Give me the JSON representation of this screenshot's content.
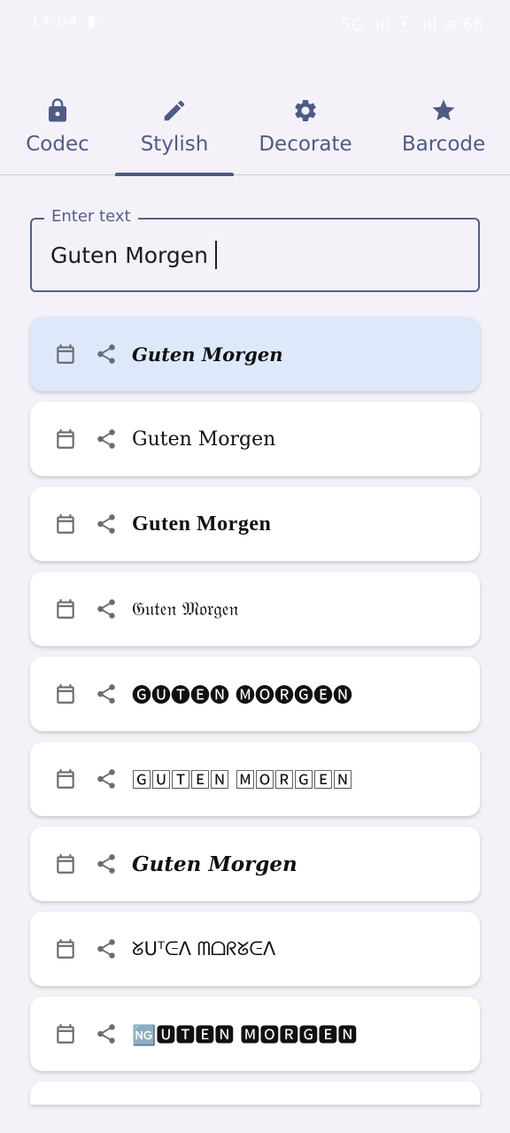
{
  "status_bar": {
    "time": "14:04",
    "left_icons": "▮ · · ·",
    "right_text": "5G .ıll ⦿ .ıll ≋ 66"
  },
  "tabs": [
    {
      "label": "Codec",
      "icon": "lock-icon",
      "active": false
    },
    {
      "label": "Stylish",
      "icon": "pencil-icon",
      "active": true
    },
    {
      "label": "Decorate",
      "icon": "gear-icon",
      "active": false
    },
    {
      "label": "Barcode",
      "icon": "star-icon",
      "active": false
    }
  ],
  "input": {
    "label": "Enter text",
    "value": "Guten Morgen"
  },
  "results": [
    {
      "text": "𝑮𝒖𝒕𝒆𝒏 𝑴𝒐𝒓𝒈𝒆𝒏",
      "selected": true
    },
    {
      "text": "Guten Morgen",
      "selected": false
    },
    {
      "text": "Guten Morgen",
      "selected": false
    },
    {
      "text": "𝔊𝔲𝔱𝔢𝔫 𝔐𝔬𝔯𝔤𝔢𝔫",
      "selected": false
    },
    {
      "text": "🅖🅤🅣🅔🅝 🅜🅞🅡🅖🅔🅝",
      "selected": false
    },
    {
      "text": "🄶🅄🅃🄴🄽 🄼🄾🅁🄶🄴🄽",
      "selected": false
    },
    {
      "text": "Guten Morgen",
      "selected": false
    },
    {
      "text": "ᘜᑌᵀᕮᐱ ᗰᗝᖇᘜᕮᐱ",
      "selected": false
    },
    {
      "text": "🆖🆄🆃🅴🅽 🅼🅾🆁🅶🅴🅽",
      "selected": false
    }
  ],
  "colors": {
    "accent": "#4f5b86",
    "background": "#f4f2f8",
    "selected_card": "#dde9fb"
  },
  "icons": {
    "copy": "calendar-icon",
    "share": "share-icon"
  }
}
